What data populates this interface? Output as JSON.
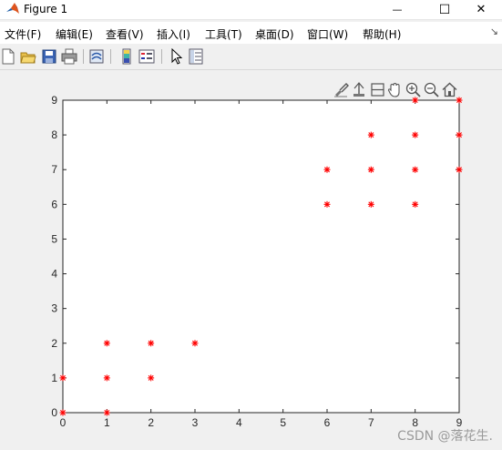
{
  "window": {
    "title": "Figure 1",
    "minimize_glyph": "—",
    "maximize_glyph": "☐",
    "close_glyph": "✕"
  },
  "menu": {
    "items": [
      {
        "label": "文件(F)"
      },
      {
        "label": "编辑(E)"
      },
      {
        "label": "查看(V)"
      },
      {
        "label": "插入(I)"
      },
      {
        "label": "工具(T)"
      },
      {
        "label": "桌面(D)"
      },
      {
        "label": "窗口(W)"
      },
      {
        "label": "帮助(H)"
      }
    ],
    "overflow_glyph": "↘"
  },
  "toolbar": {
    "icons": [
      "new-figure-icon",
      "open-file-icon",
      "save-icon",
      "print-icon",
      "link-plot-icon",
      "insert-colorbar-icon",
      "insert-legend-icon",
      "edit-plot-icon",
      "property-inspector-icon"
    ]
  },
  "axes_toolbar": {
    "icons": [
      "brush-icon",
      "data-tips-icon",
      "rotate-icon",
      "pan-icon",
      "zoom-in-icon",
      "zoom-out-icon",
      "restore-view-icon"
    ]
  },
  "chart_data": {
    "type": "scatter",
    "marker": "*",
    "marker_color": "#ff0000",
    "xlim": [
      0,
      9
    ],
    "ylim": [
      0,
      9
    ],
    "xticks": [
      "0",
      "1",
      "2",
      "3",
      "4",
      "5",
      "6",
      "7",
      "8",
      "9"
    ],
    "yticks": [
      "0",
      "1",
      "2",
      "3",
      "4",
      "5",
      "6",
      "7",
      "8",
      "9"
    ],
    "grid": false,
    "points": [
      [
        0,
        0
      ],
      [
        0,
        1
      ],
      [
        1,
        0
      ],
      [
        1,
        1
      ],
      [
        1,
        2
      ],
      [
        2,
        1
      ],
      [
        2,
        2
      ],
      [
        3,
        2
      ],
      [
        6,
        6
      ],
      [
        6,
        7
      ],
      [
        7,
        6
      ],
      [
        7,
        7
      ],
      [
        7,
        8
      ],
      [
        8,
        6
      ],
      [
        8,
        7
      ],
      [
        8,
        8
      ],
      [
        8,
        9
      ],
      [
        9,
        7
      ],
      [
        9,
        8
      ],
      [
        9,
        9
      ]
    ]
  },
  "watermark": "CSDN @落花生."
}
